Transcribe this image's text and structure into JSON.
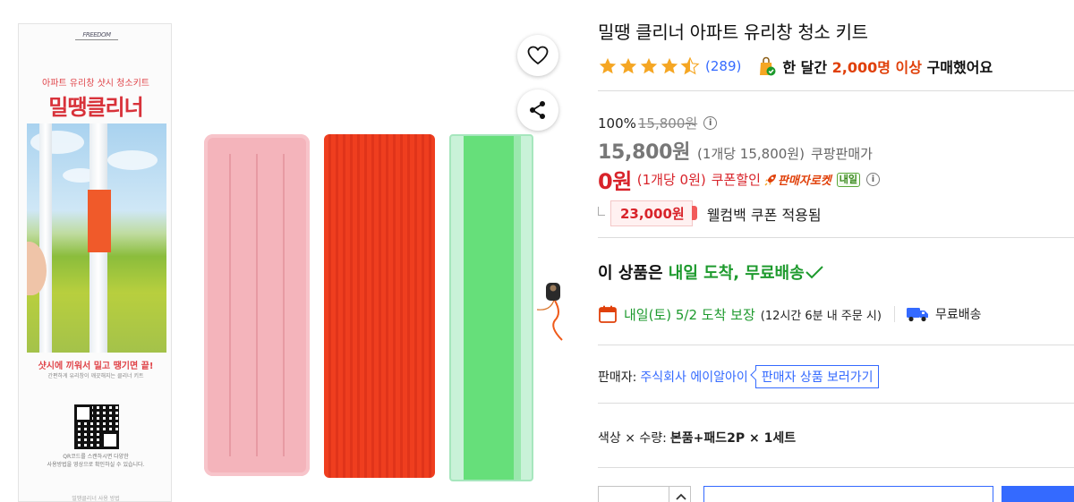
{
  "product": {
    "title": "밀땡 클리너 아파트 유리창 청소 키트",
    "rating": 4.5,
    "review_count": "(289)",
    "purchase_prefix": "한 달간",
    "purchase_highlight": "2,000명 이상",
    "purchase_suffix": "구매했어요"
  },
  "price": {
    "discount_rate": "100%",
    "original_price": "15,800원",
    "sale_price": "15,800원",
    "unit_price": "(1개당 15,800원)",
    "seller_type": "쿠팡판매가",
    "coupon_price": "0원",
    "coupon_unit_price": "(1개당 0원)",
    "coupon_label": "쿠폰할인",
    "seller_rocket": "판매자로켓",
    "rocket_badge": "내일",
    "welcome_amount": "23,000원",
    "welcome_text": "웰컴백 쿠폰 적용됨"
  },
  "delivery": {
    "headline_prefix": "이 상품은",
    "headline_green": "내일 도착, 무료배송",
    "arrival": "내일(토) 5/2 도착 보장",
    "cutoff": "(12시간 6분 내 주문 시)",
    "free_shipping": "무료배송"
  },
  "seller": {
    "label": "판매자:",
    "name": "주식회사 에이알아이",
    "link": "판매자 상품 보러가기"
  },
  "option": {
    "label": "색상 × 수량:",
    "value": "본품+패드2P × 1세트"
  },
  "package": {
    "brand": "FREEDOM",
    "subtitle": "아파트 유리창 샷시 청소키트",
    "title": "밀땡클리너",
    "tagline": "샷시에 끼워서 밀고 땡기면 끝!",
    "tagline_sub": "간편하게 유리창이 깨끗해지는 클리너 키트",
    "qr_caption_1": "QR코드를 스캔하시면 다양한",
    "qr_caption_2": "사용방법을 영상으로 확인하실 수 있습니다.",
    "bottom_text": "밀땡클리너 사용 방법"
  },
  "colors": {
    "accent_blue": "#346aff",
    "price_red": "#d8232a",
    "delivery_green": "#1d9a2d",
    "star_orange": "#f5a623"
  },
  "icons": [
    "heart-icon",
    "share-icon",
    "star-icon",
    "shopping-bag-icon",
    "info-icon",
    "rocket-icon",
    "check-icon",
    "calendar-icon",
    "truck-icon",
    "chevron-up-icon"
  ]
}
